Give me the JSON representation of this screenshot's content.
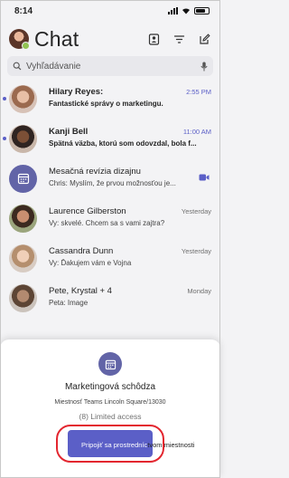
{
  "status_bar": {
    "time": "8:14"
  },
  "header": {
    "title": "Chat"
  },
  "search": {
    "placeholder": "Vyhľadávanie"
  },
  "chats": [
    {
      "name": "Hilary Reyes:",
      "time": "2:55 PM",
      "preview": "Fantastické správy o marketingu.",
      "unread": true
    },
    {
      "name": "Kanji Bell",
      "time": "11:00 AM",
      "preview": "Spätná väzba, ktorú som odovzdal, bola f...",
      "unread": true
    },
    {
      "name": "Mesačná revízia dizajnu",
      "time": "",
      "preview": "Chris: Myslím, že prvou možnosťou je...",
      "unread": false,
      "meeting": true
    },
    {
      "name": "Laurence Gilberston",
      "time": "Yesterday",
      "preview": "Vy: skvelé. Chcem sa s vami zajtra?",
      "unread": false
    },
    {
      "name": "Cassandra Dunn",
      "time": "Yesterday",
      "preview": "Vy: Ďakujem vám e Vojna",
      "unread": false
    },
    {
      "name": "Pete, Krystal + 4",
      "time": "Monday",
      "preview": "Peta: Image",
      "unread": false
    }
  ],
  "sheet": {
    "title": "Marketingová schôdza",
    "room": "Miestnosť Teams Lincoln Square/13030",
    "access": "(8) Limited access",
    "join_label_inside": "Pripojiť sa prostredníc",
    "join_label_outside": "tvom miestnosti"
  },
  "colors": {
    "accent": "#5b5fc7",
    "highlight": "#e3262f",
    "meeting_avatar": "#6264a7"
  }
}
